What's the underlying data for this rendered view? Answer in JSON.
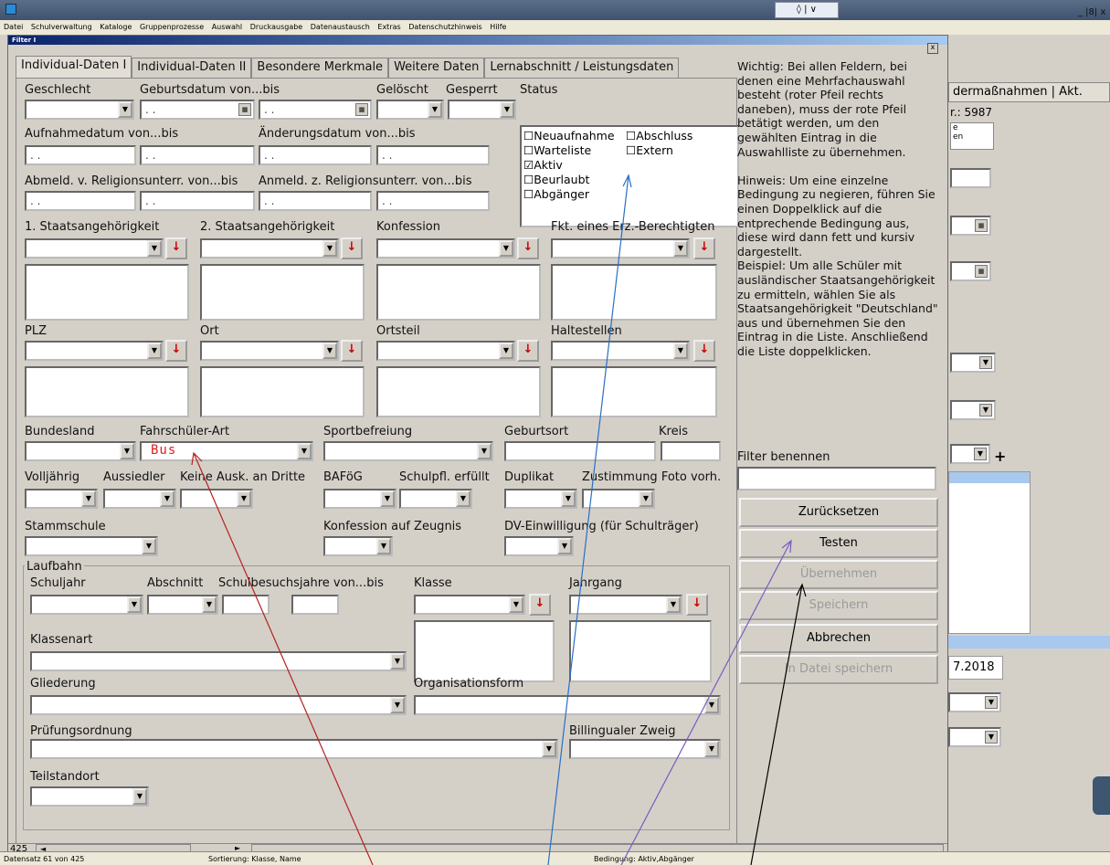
{
  "window": {
    "tab_label": "Filter I",
    "close": "x",
    "controls": "_ |8| x",
    "search_tab": "◊ | ∨"
  },
  "menu": [
    "Datei",
    "Schulverwaltung",
    "Kataloge",
    "Gruppenprozesse",
    "Auswahl",
    "Druckausgabe",
    "Datenaustausch",
    "Extras",
    "Datenschutzhinweis",
    "Hilfe"
  ],
  "tabs": [
    "Individual-Daten I",
    "Individual-Daten II",
    "Besondere Merkmale",
    "Weitere Daten",
    "Lernabschnitt / Leistungsdaten"
  ],
  "labels": {
    "geschlecht": "Geschlecht",
    "geburtsdatum": "Geburtsdatum von...bis",
    "geloescht": "Gelöscht",
    "gesperrt": "Gesperrt",
    "status": "Status",
    "aufnahme": "Aufnahmedatum von...bis",
    "aenderung": "Änderungsdatum von...bis",
    "abmeld": "Abmeld. v. Religionsunterr. von...bis",
    "anmeld": "Anmeld. z. Religionsunterr. von...bis",
    "sta1": "1. Staatsangehörigkeit",
    "sta2": "2. Staatsangehörigkeit",
    "konfession": "Konfession",
    "fkt": "Fkt. eines Erz.-Berechtigten",
    "plz": "PLZ",
    "ort": "Ort",
    "ortsteil": "Ortsteil",
    "haltestellen": "Haltestellen",
    "bundesland": "Bundesland",
    "fahrschueler": "Fahrschüler-Art",
    "sportbefreiung": "Sportbefreiung",
    "geburtsort": "Geburtsort",
    "kreis": "Kreis",
    "volljaehrig": "Volljährig",
    "aussiedler": "Aussiedler",
    "keine_ausk": "Keine Ausk. an Dritte",
    "bafoeg": "BAFöG",
    "schulpfl": "Schulpfl. erfüllt",
    "duplikat": "Duplikat",
    "zustimmung": "Zustimmung Foto vorh.",
    "stammschule": "Stammschule",
    "konf_zeugnis": "Konfession auf Zeugnis",
    "dv_einw": "DV-Einwilligung (für Schulträger)",
    "laufbahn": "Laufbahn",
    "schuljahr": "Schuljahr",
    "abschnitt": "Abschnitt",
    "schulbesuch": "Schulbesuchsjahre von...bis",
    "klasse": "Klasse",
    "jahrgang": "Jahrgang",
    "klassenart": "Klassenart",
    "gliederung": "Gliederung",
    "orgform": "Organisationsform",
    "pruefung": "Prüfungsordnung",
    "biling": "Billingualer Zweig",
    "teilstandort": "Teilstandort"
  },
  "date_placeholder": ". .",
  "fahrschueler_value": "Bus",
  "status_options": {
    "neuaufnahme": "Neuaufnahme",
    "abschluss": "Abschluss",
    "warteliste": "Warteliste",
    "extern": "Extern",
    "aktiv": "Aktiv",
    "beurlaubt": "Beurlaubt",
    "abgaenger": "Abgänger"
  },
  "checked": {
    "aktiv": true
  },
  "help_text": "Wichtig: Bei allen Feldern, bei denen eine Mehrfachauswahl besteht (roter Pfeil rechts daneben), muss der rote Pfeil betätigt werden, um den gewählten Eintrag in die Auswahlliste zu übernehmen.\n\nHinweis: Um eine einzelne Bedingung zu negieren, führen Sie einen Doppelklick auf die entprechende Bedingung aus, diese wird dann fett und kursiv dargestellt.\nBeispiel: Um alle Schüler mit ausländischer Staatsangehörigkeit zu ermitteln, wählen Sie als Staatsangehörigkeit \"Deutschland\" aus und übernehmen Sie den Eintrag in die Liste. Anschließend die Liste doppelklicken.",
  "filter_benennen": "Filter benennen",
  "buttons": {
    "reset": "Zurücksetzen",
    "test": "Testen",
    "apply": "Übernehmen",
    "save": "Speichern",
    "cancel": "Abbrechen",
    "save_file": "In Datei speichern"
  },
  "right": {
    "tabs": "dermaßnahmen | Akt.",
    "nr": "r.: 5987",
    "date": "7.2018",
    "e": "e",
    "en": "en"
  },
  "nav": "425",
  "statusbar": {
    "record": "Datensatz 61 von 425",
    "sort": "Sortierung: Klasse, Name",
    "cond": "Bedingung: Aktiv,Abgänger"
  },
  "colors": {
    "annot_blue": "#2a6fc4",
    "annot_red": "#b52020",
    "annot_purple": "#7b5bbf",
    "annot_black": "#000000",
    "title_blue": "#0a246a"
  }
}
